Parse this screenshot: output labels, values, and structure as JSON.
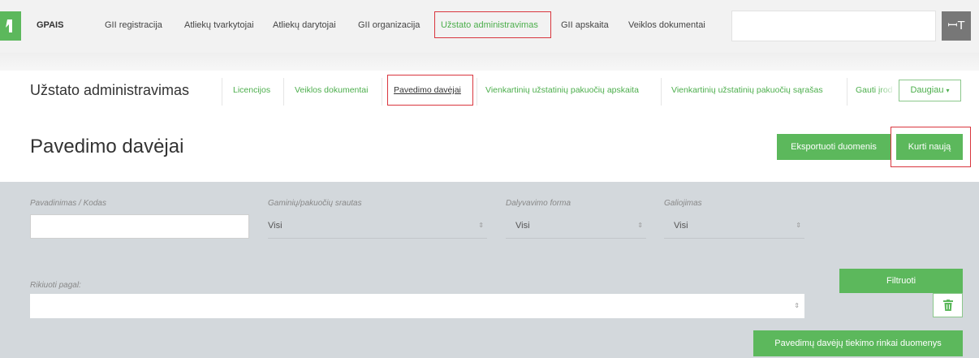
{
  "topnav": {
    "brand": "GPAIS",
    "items": [
      "GII registracija",
      "Atliekų tvarkytojai",
      "Atliekų darytojai",
      "GII organizacija",
      "Užstato administravimas",
      "GII apskaita",
      "Veiklos dokumentai"
    ],
    "user_glyph": "ꟷT"
  },
  "subnav": {
    "title": "Užstato administravimas",
    "tabs": [
      "Licencijos",
      "Veiklos dokumentai",
      "Pavedimo davėjai",
      "Vienkartinių užstatinių pakuočių apskaita",
      "Vienkartinių užstatinių pakuočių sąrašas",
      "Gauti įrod"
    ],
    "more_label": "Daugiau",
    "more_caret": "▾"
  },
  "page": {
    "title": "Pavedimo davėjai",
    "export_label": "Eksportuoti duomenis",
    "new_label": "Kurti naują"
  },
  "filters": {
    "name_label": "Pavadinimas / Kodas",
    "name_value": "",
    "stream_label": "Gaminių/pakuočių srautas",
    "stream_value": "Visi",
    "form_label": "Dalyvavimo forma",
    "form_value": "Visi",
    "validity_label": "Galiojimas",
    "validity_value": "Visi",
    "sort_label": "Rikiuoti pagal:",
    "sort_value": "",
    "filter_button": "Filtruoti",
    "supply_button": "Pavedimų davėjų tiekimo rinkai duomenys"
  },
  "colors": {
    "accent_green": "#5cb85c",
    "highlight_red": "#d9363e",
    "panel_bg": "#d3d8dc"
  }
}
